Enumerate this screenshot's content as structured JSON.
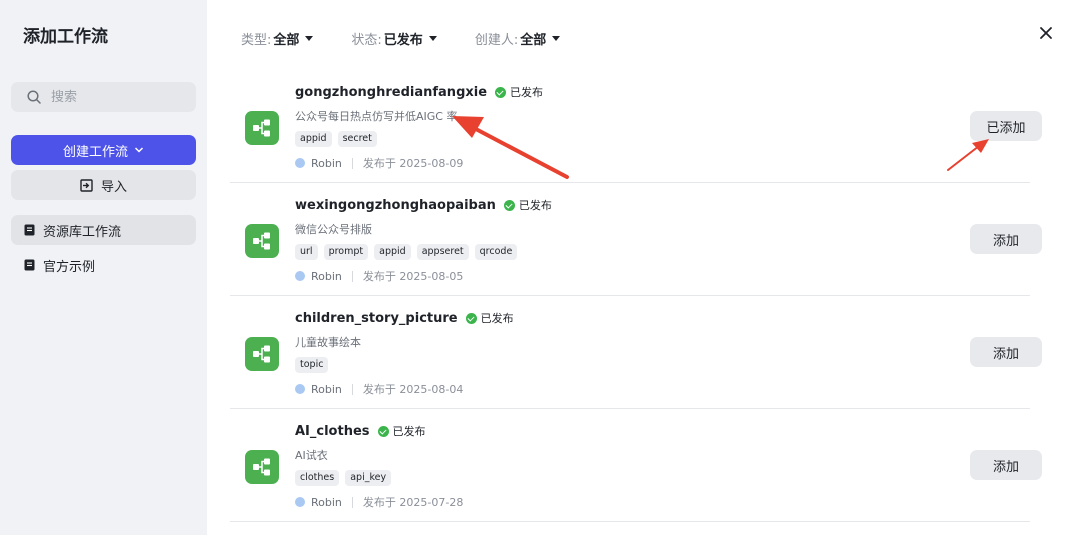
{
  "sidebar": {
    "title": "添加工作流",
    "search_placeholder": "搜索",
    "create_label": "创建工作流",
    "import_label": "导入",
    "nav": [
      {
        "label": "资源库工作流",
        "active": true
      },
      {
        "label": "官方示例",
        "active": false
      }
    ]
  },
  "filters": [
    {
      "key": "类型:",
      "value": "全部"
    },
    {
      "key": "状态:",
      "value": "已发布"
    },
    {
      "key": "创建人:",
      "value": "全部"
    }
  ],
  "workflows": [
    {
      "name": "gongzhonghredianfangxie",
      "status": "已发布",
      "desc": "公众号每日热点仿写并低AIGC 率",
      "tags": [
        "appid",
        "secret"
      ],
      "author": "Robin",
      "published": "发布于 2025-08-09",
      "action": "已添加"
    },
    {
      "name": "wexingongzhonghaopaiban",
      "status": "已发布",
      "desc": "微信公众号排版",
      "tags": [
        "url",
        "prompt",
        "appid",
        "appseret",
        "qrcode"
      ],
      "author": "Robin",
      "published": "发布于 2025-08-05",
      "action": "添加"
    },
    {
      "name": "children_story_picture",
      "status": "已发布",
      "desc": "儿童故事绘本",
      "tags": [
        "topic"
      ],
      "author": "Robin",
      "published": "发布于 2025-08-04",
      "action": "添加"
    },
    {
      "name": "AI_clothes",
      "status": "已发布",
      "desc": "AI试衣",
      "tags": [
        "clothes",
        "api_key"
      ],
      "author": "Robin",
      "published": "发布于 2025-07-28",
      "action": "添加"
    }
  ],
  "colors": {
    "primary": "#4d53e8",
    "workflow_icon": "#4caf50",
    "status_ok": "#3ab44b",
    "annotation_arrow": "#e8412f"
  },
  "icons": {
    "search": "search-icon",
    "chevron": "chevron-down-icon",
    "import": "import-icon",
    "library": "book-icon",
    "close": "close-icon",
    "workflow": "workflow-icon",
    "status": "check-circle-icon"
  }
}
